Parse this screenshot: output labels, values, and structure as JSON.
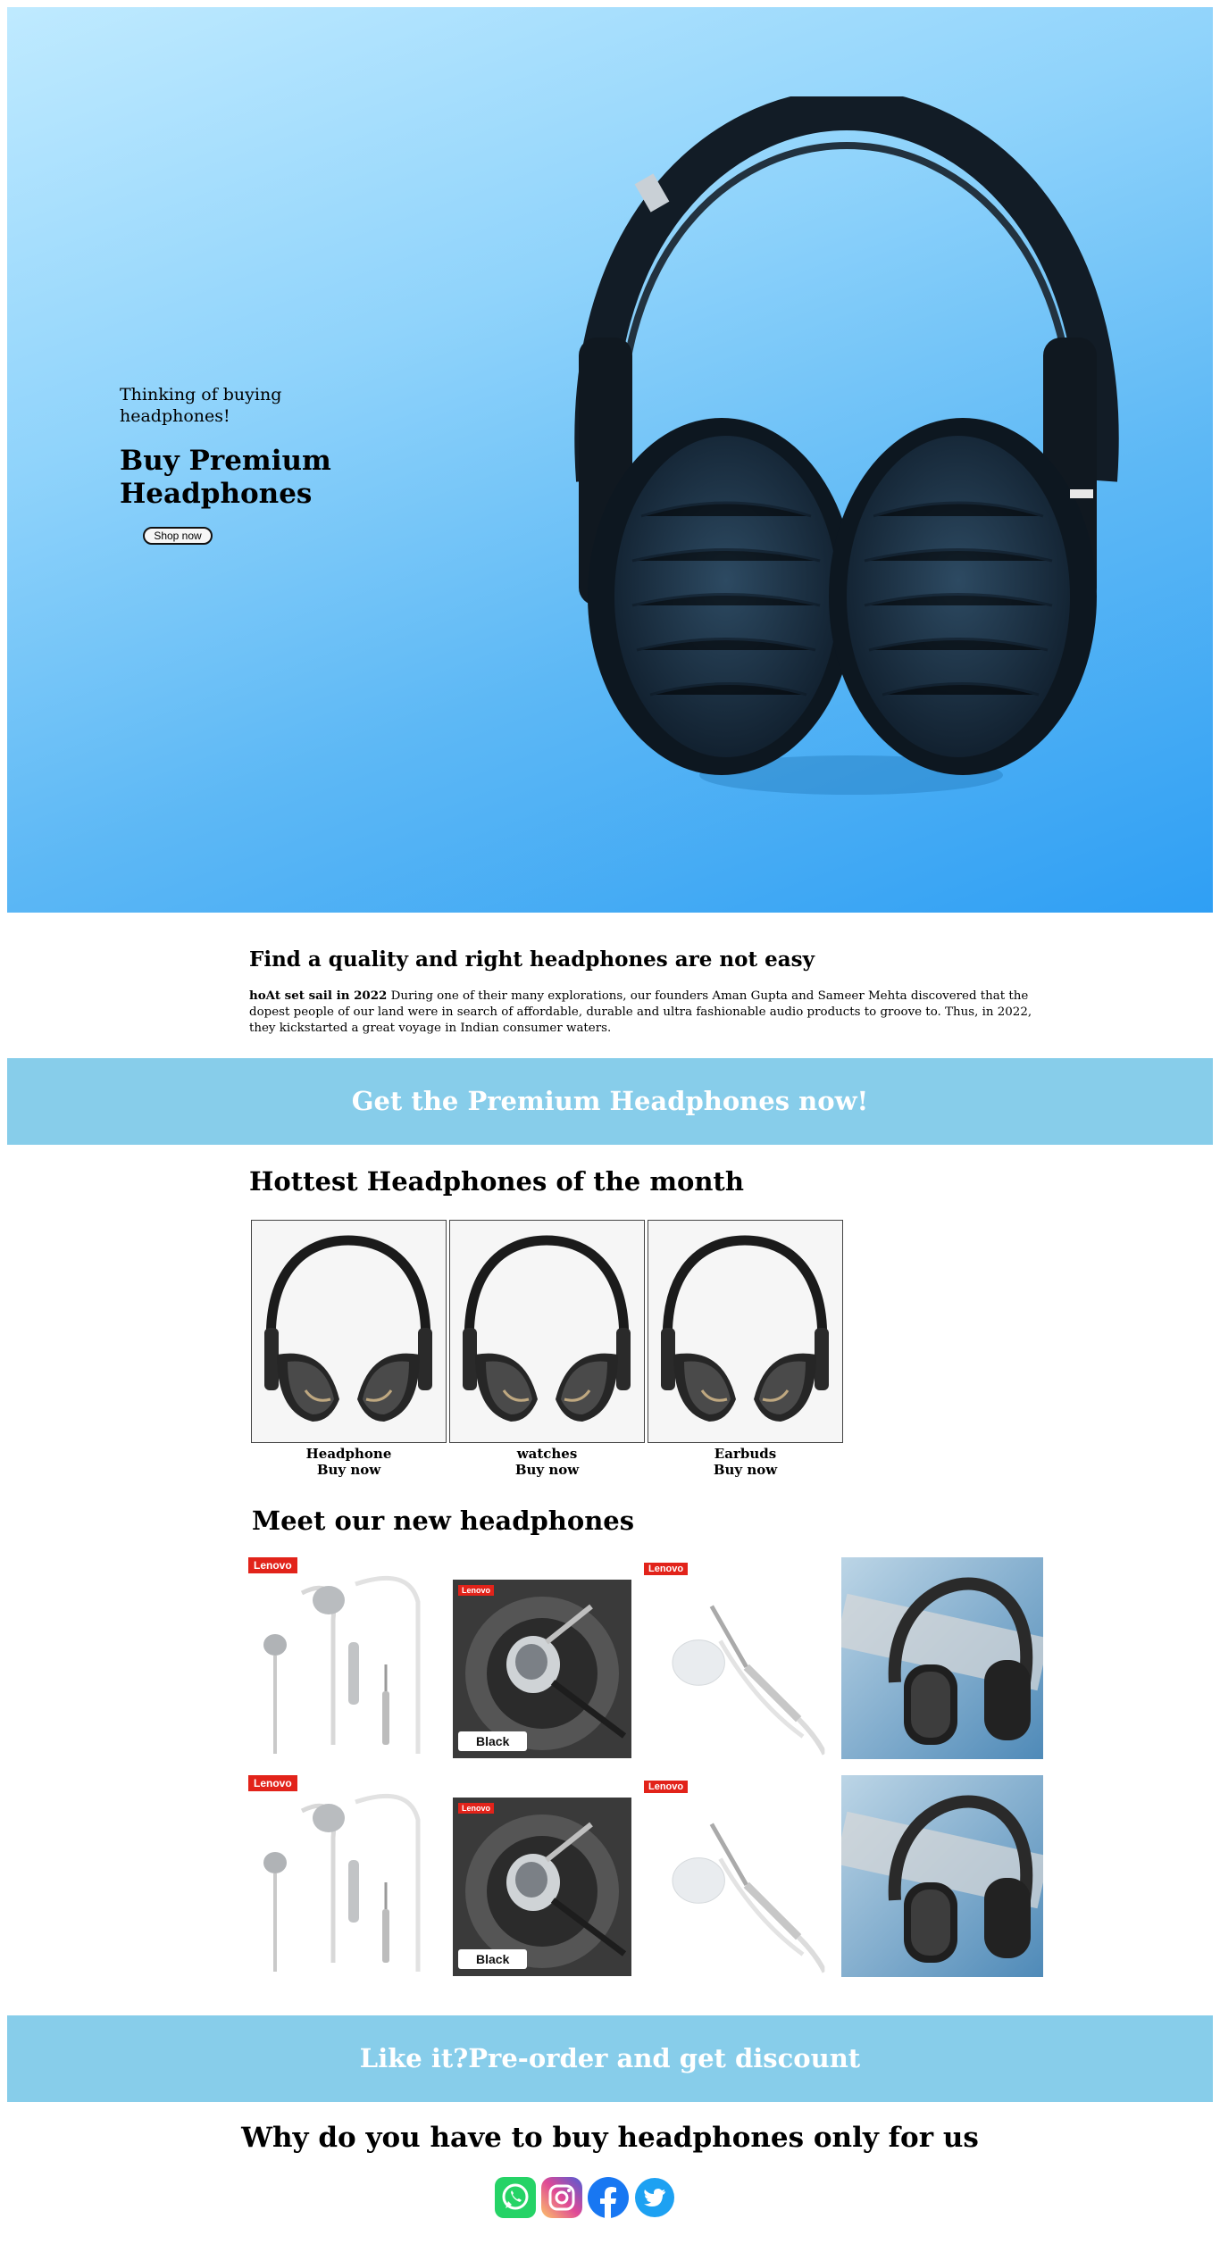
{
  "hero": {
    "kicker": "Thinking of buying headphones!",
    "title": "Buy Premium Headphones",
    "button_label": "Shop now"
  },
  "intro": {
    "heading": "Find a quality and right headphones are not easy",
    "lead_bold": "hoAt set sail in 2022",
    "body": " During one of their many explorations, our founders Aman Gupta and Sameer Mehta discovered that the dopest people of our land were in search of affordable, durable and ultra fashionable audio products to groove to. Thus, in 2022, they kickstarted a great voyage in Indian consumer waters."
  },
  "banner_top": {
    "text": "Get the Premium Headphones now!"
  },
  "hottest": {
    "heading": "Hottest Headphones of the month",
    "cards": [
      {
        "name": "Headphone",
        "buy": "Buy now"
      },
      {
        "name": "watches",
        "buy": "Buy now"
      },
      {
        "name": "Earbuds",
        "buy": "Buy now"
      }
    ]
  },
  "meet": {
    "heading": "Meet our new headphones",
    "tiles": [
      {
        "brand": "Lenovo",
        "kind": "earphones-white"
      },
      {
        "brand": "Lenovo",
        "kind": "earbud-black",
        "tag": "Black"
      },
      {
        "brand": "Lenovo",
        "kind": "earbud-white"
      },
      {
        "brand": "",
        "kind": "over-ear-black"
      },
      {
        "brand": "Lenovo",
        "kind": "earphones-white"
      },
      {
        "brand": "Lenovo",
        "kind": "earbud-black",
        "tag": "Black"
      },
      {
        "brand": "Lenovo",
        "kind": "earbud-white"
      },
      {
        "brand": "",
        "kind": "over-ear-black"
      }
    ]
  },
  "banner_bottom": {
    "text": "Like it?Pre-order and get discount"
  },
  "why": {
    "heading": "Why do you have to buy headphones only for us"
  },
  "socials": [
    {
      "icon": "whatsapp-icon",
      "color": "#25d366"
    },
    {
      "icon": "instagram-icon",
      "color": "#d6249f"
    },
    {
      "icon": "facebook-icon",
      "color": "#1877f2"
    },
    {
      "icon": "twitter-icon",
      "color": "#1da1f2"
    }
  ]
}
